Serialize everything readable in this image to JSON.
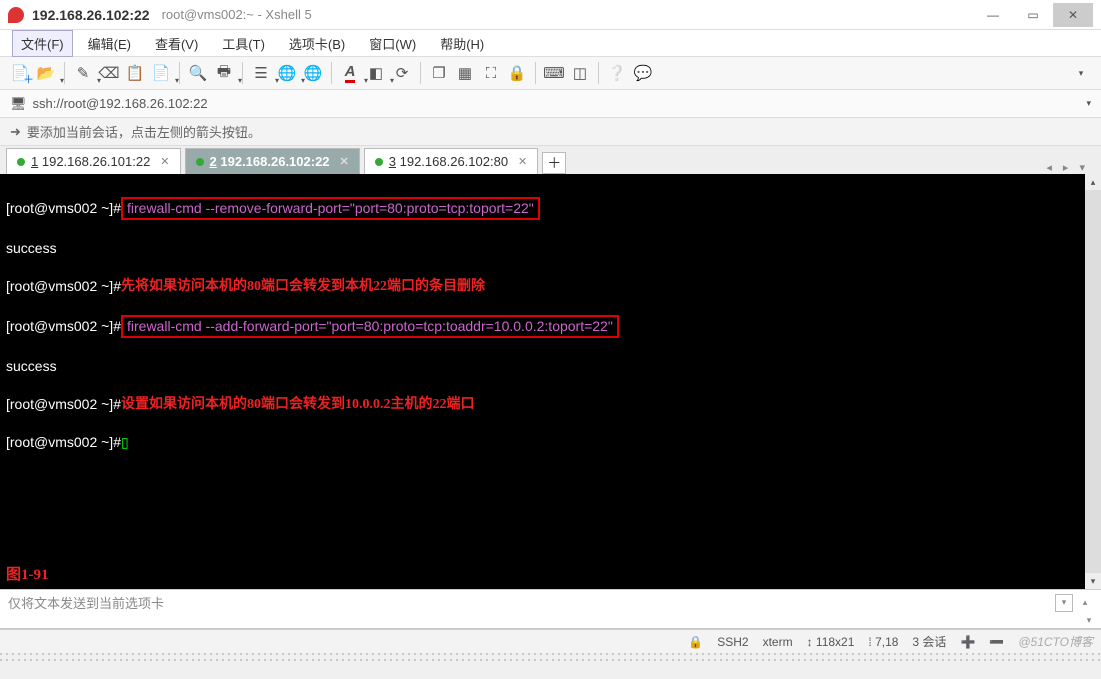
{
  "window": {
    "title_main": "192.168.26.102:22",
    "title_sub": "root@vms002:~ - Xshell 5"
  },
  "menubar": {
    "items": [
      {
        "label": "文件(F)"
      },
      {
        "label": "编辑(E)"
      },
      {
        "label": "查看(V)"
      },
      {
        "label": "工具(T)"
      },
      {
        "label": "选项卡(B)"
      },
      {
        "label": "窗口(W)"
      },
      {
        "label": "帮助(H)"
      }
    ]
  },
  "toolbar_icons": {
    "new": "new-file",
    "open": "open",
    "pencil": "edit",
    "eraser": "eraser",
    "copy": "copy",
    "paste": "paste",
    "search": "search",
    "print": "print",
    "props": "properties",
    "globe": "globe",
    "globe2": "session",
    "font": "font-color",
    "colors": "colors",
    "refresh": "reconnect",
    "cascade": "cascade",
    "tile": "tile",
    "fullscreen": "fullscreen",
    "lock": "lock",
    "keyboard": "keyboard",
    "view": "view-panel",
    "help": "help",
    "chat": "chat"
  },
  "address": {
    "url": "ssh://root@192.168.26.102:22"
  },
  "tipbar": {
    "text": "要添加当前会话，点击左侧的箭头按钮。"
  },
  "tabs": [
    {
      "idx": "1",
      "label": "192.168.26.101:22",
      "active": false
    },
    {
      "idx": "2",
      "label": "192.168.26.102:22",
      "active": true
    },
    {
      "idx": "3",
      "label": "192.168.26.102:80",
      "active": false
    }
  ],
  "terminal": {
    "prompt": "[root@vms002 ~]#",
    "cmd1": "firewall-cmd --remove-forward-port=\"port=80:proto=tcp:toport=22\"",
    "out1": "success",
    "anno1": "先将如果访问本机的80端口会转发到本机22端口的条目删除",
    "cmd2": "firewall-cmd --add-forward-port=\"port=80:proto=tcp:toaddr=10.0.0.2:toport=22\"",
    "out2": "success",
    "anno2": "设置如果访问本机的80端口会转发到10.0.0.2主机的22端口",
    "figlabel": "图1-91"
  },
  "inputbar": {
    "placeholder": "仅将文本发送到当前选项卡"
  },
  "statusbar": {
    "protocol": "SSH2",
    "termtype": "xterm",
    "size": "118x21",
    "cursor": "7,18",
    "sessions": "3 会话",
    "watermark": "@51CTO博客",
    "lock": "🔒",
    "arrows": "↕"
  }
}
